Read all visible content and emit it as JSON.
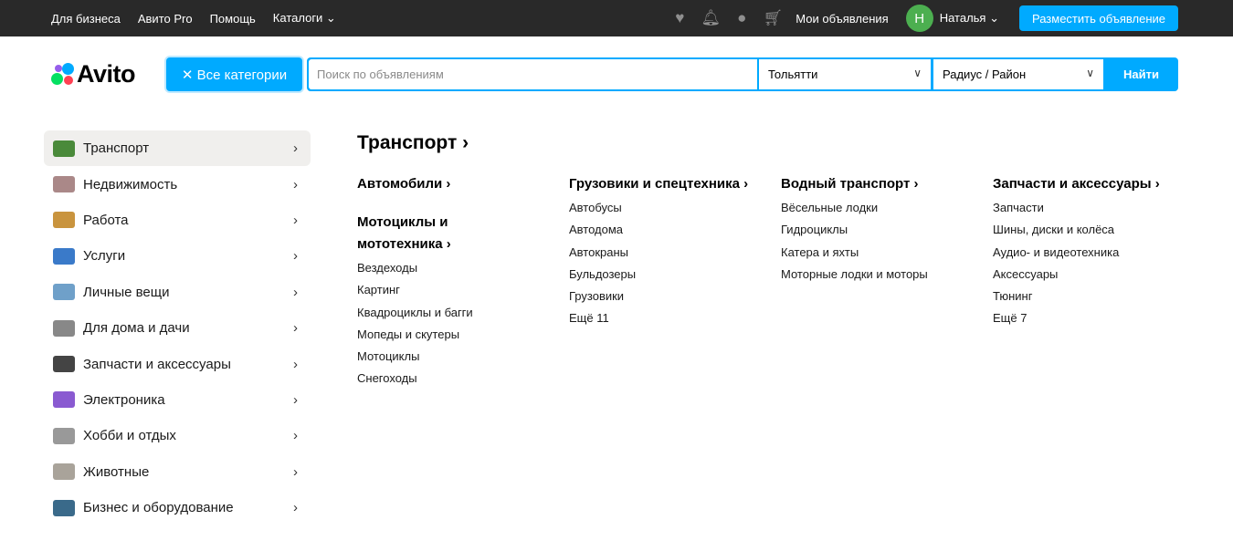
{
  "topbar": {
    "links": [
      "Для бизнеса",
      "Авито Pro",
      "Помощь",
      "Каталоги ⌄"
    ],
    "my_ads": "Мои объявления",
    "avatar_letter": "Н",
    "user": "Наталья ⌄",
    "post": "Разместить объявление"
  },
  "logo": "Avito",
  "search": {
    "categories": "✕  Все категории",
    "placeholder": "Поиск по объявлениям",
    "city": "Тольятти",
    "radius": "Радиус / Район",
    "find": "Найти"
  },
  "sidebar": [
    {
      "label": "Транспорт",
      "color": "#4a8a3a"
    },
    {
      "label": "Недвижимость",
      "color": "#a88"
    },
    {
      "label": "Работа",
      "color": "#c9943e"
    },
    {
      "label": "Услуги",
      "color": "#3a7ac9"
    },
    {
      "label": "Личные вещи",
      "color": "#6fa0c9"
    },
    {
      "label": "Для дома и дачи",
      "color": "#888"
    },
    {
      "label": "Запчасти и аксессуары",
      "color": "#444"
    },
    {
      "label": "Электроника",
      "color": "#8a5ad1"
    },
    {
      "label": "Хобби и отдых",
      "color": "#999"
    },
    {
      "label": "Животные",
      "color": "#a9a39a"
    },
    {
      "label": "Бизнес и оборудование",
      "color": "#3a6a8a"
    }
  ],
  "heading": "Транспорт ›",
  "columns": [
    {
      "groups": [
        {
          "title": "Автомобили ›",
          "items": []
        },
        {
          "title": "Мотоциклы и мототехника ›",
          "items": [
            "Вездеходы",
            "Картинг",
            "Квадроциклы и багги",
            "Мопеды и скутеры",
            "Мотоциклы",
            "Снегоходы"
          ]
        }
      ]
    },
    {
      "groups": [
        {
          "title": "Грузовики и спецтехника ›",
          "items": [
            "Автобусы",
            "Автодома",
            "Автокраны",
            "Бульдозеры",
            "Грузовики",
            "Ещё 11"
          ]
        }
      ]
    },
    {
      "groups": [
        {
          "title": "Водный транспорт ›",
          "items": [
            "Вёсельные лодки",
            "Гидроциклы",
            "Катера и яхты",
            "Моторные лодки и моторы"
          ]
        }
      ]
    },
    {
      "groups": [
        {
          "title": "Запчасти и аксессуары ›",
          "items": [
            "Запчасти",
            "Шины, диски и колёса",
            "Аудио- и видеотехника",
            "Аксессуары",
            "Тюнинг",
            "Ещё 7"
          ]
        }
      ]
    }
  ]
}
